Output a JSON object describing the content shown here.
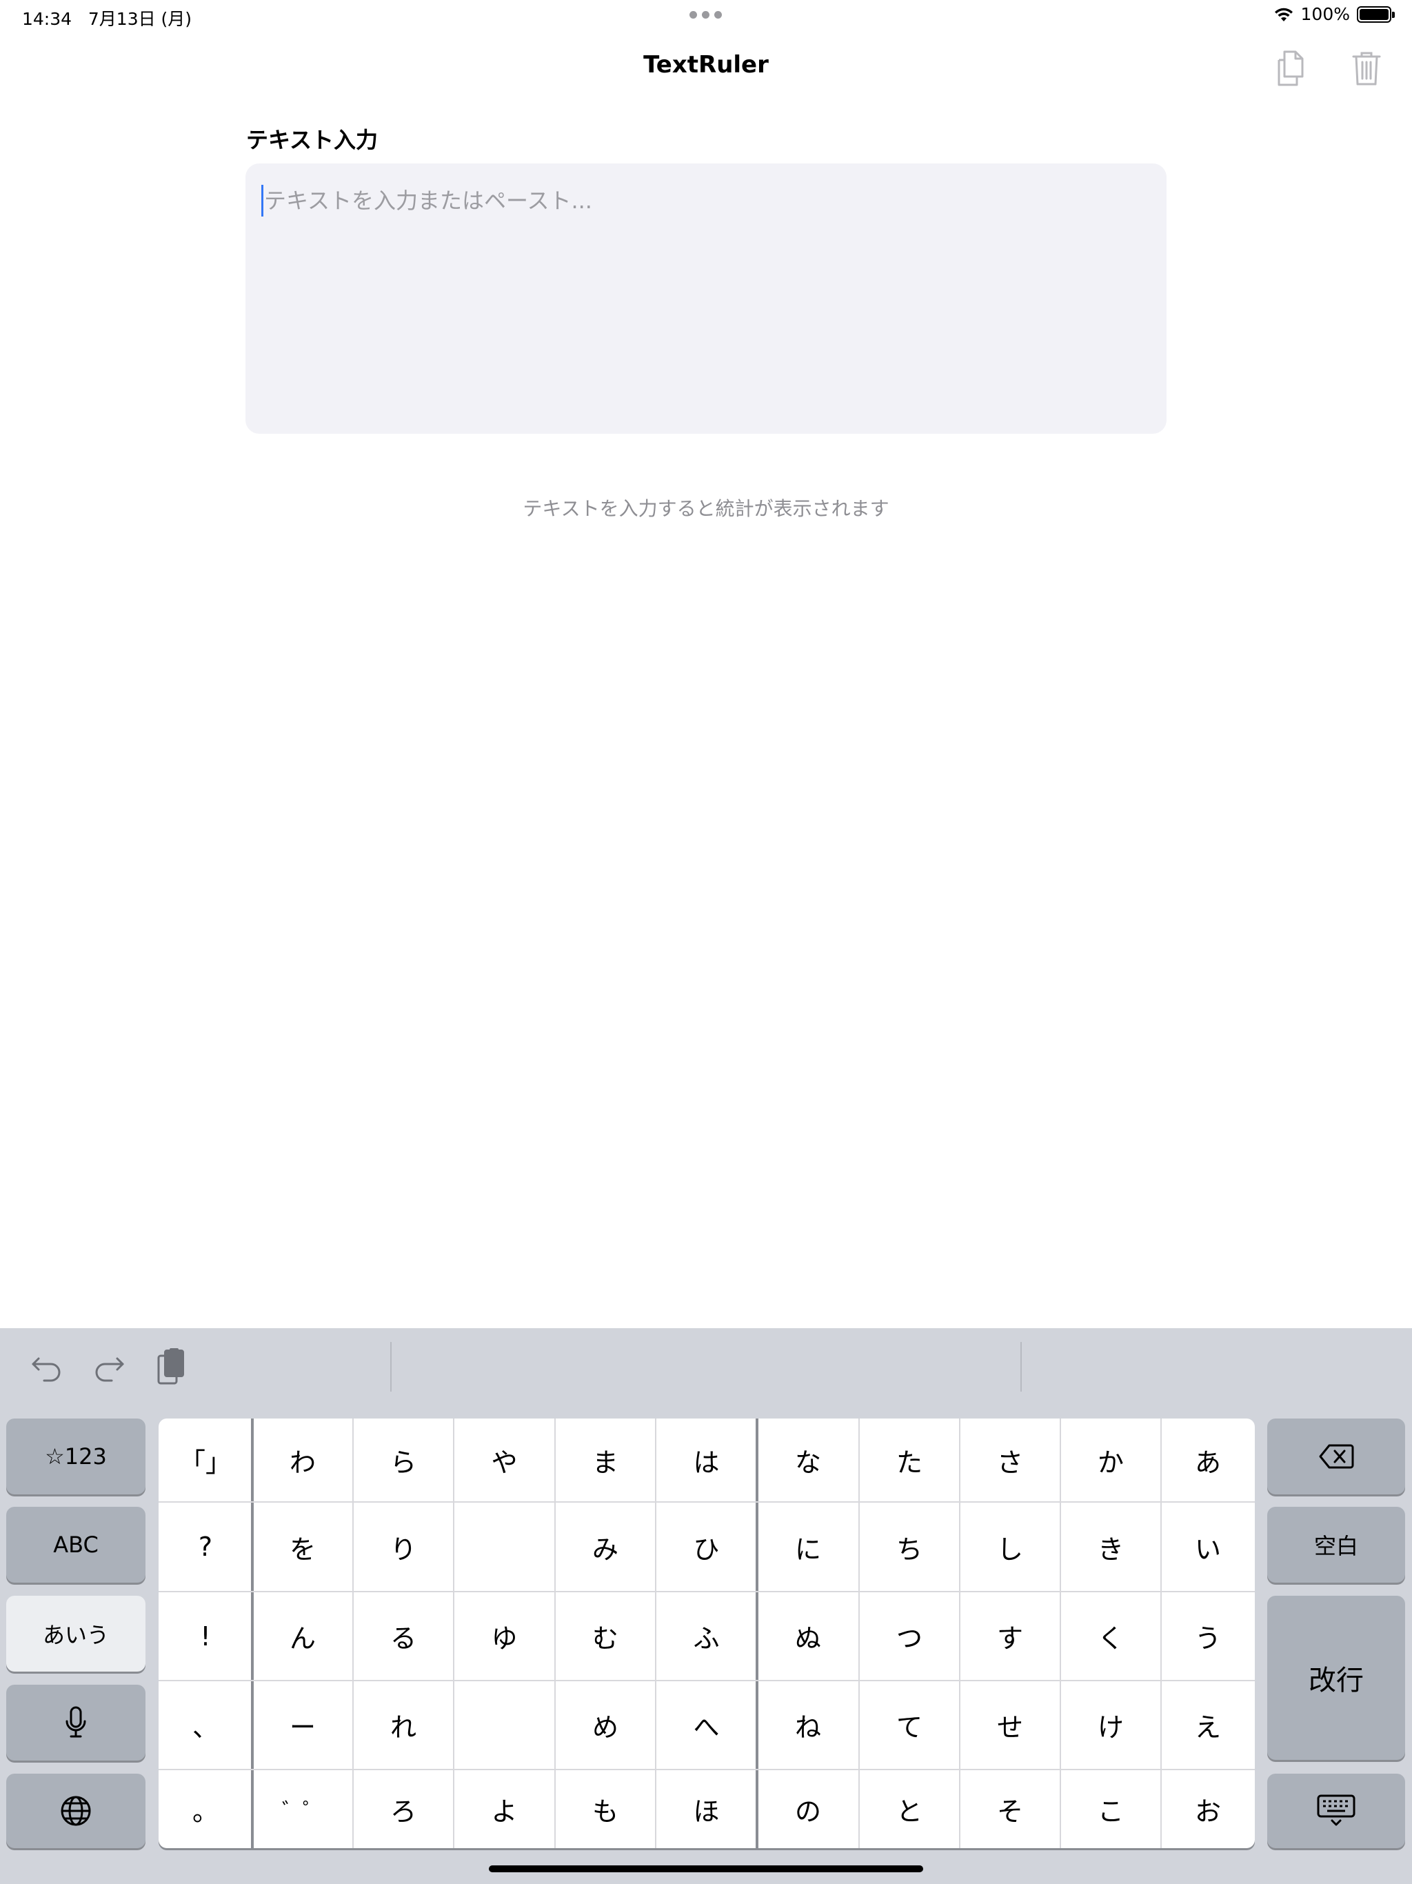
{
  "status_bar": {
    "time": "14:34",
    "date": "7月13日 (月)",
    "battery_percent": "100%",
    "battery_level": 1.0
  },
  "nav": {
    "title": "TextRuler",
    "copy_icon": "copy-icon",
    "trash_icon": "trash-icon"
  },
  "input_section": {
    "title": "テキスト入力",
    "placeholder": "テキストを入力またはペースト...",
    "hint": "テキストを入力すると統計が表示されます"
  },
  "keyboard": {
    "toolbar": {
      "undo_icon": "undo-icon",
      "redo_icon": "redo-icon",
      "clipboard_icon": "clipboard-icon"
    },
    "left_keys": {
      "numbers": "☆123",
      "abc": "ABC",
      "kana": "あいう",
      "mic_icon": "microphone-icon",
      "globe_icon": "globe-icon"
    },
    "right_keys": {
      "delete_icon": "delete-icon",
      "space": "空白",
      "return": "改行",
      "hide_keyboard_icon": "keyboard-dismiss-icon"
    },
    "kana_columns": [
      [
        "「」",
        "?",
        "!",
        "、",
        "。"
      ],
      [
        "わ",
        "を",
        "ん",
        "ー",
        "゛゜"
      ],
      [
        "ら",
        "り",
        "る",
        "れ",
        "ろ"
      ],
      [
        "や",
        "",
        "ゆ",
        "",
        "よ"
      ],
      [
        "ま",
        "み",
        "む",
        "め",
        "も"
      ],
      [
        "は",
        "ひ",
        "ふ",
        "へ",
        "ほ"
      ],
      [
        "な",
        "に",
        "ぬ",
        "ね",
        "の"
      ],
      [
        "た",
        "ち",
        "つ",
        "て",
        "と"
      ],
      [
        "さ",
        "し",
        "す",
        "せ",
        "そ"
      ],
      [
        "か",
        "き",
        "く",
        "け",
        "こ"
      ],
      [
        "あ",
        "い",
        "う",
        "え",
        "お"
      ]
    ]
  }
}
